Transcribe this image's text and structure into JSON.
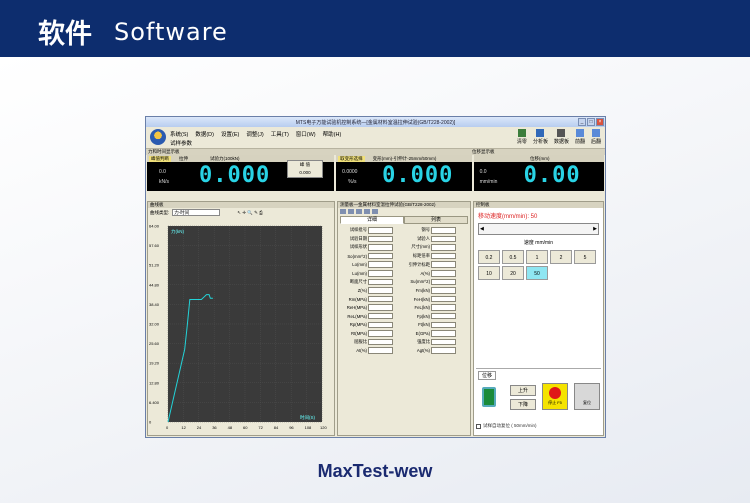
{
  "header": {
    "title_cn": "软件",
    "title_en": "Software"
  },
  "caption": "MaxTest-wew",
  "app": {
    "window_title": "MTS电子万能试验机控制系统—[金属材料室温拉伸试验(GB/T228-2002)]",
    "menus": [
      "系统(S)",
      "数据(D)",
      "设置(E)",
      "调整(J)",
      "工具(T)",
      "窗口(W)",
      "帮助(H)"
    ],
    "menu_second": "试样参数",
    "toolbar": [
      "清零",
      "分析板",
      "数据板",
      "前翻",
      "后翻"
    ],
    "strip_left": "力和时间显示板",
    "strip_right": "位移显示板",
    "meter1": {
      "tab_selected": "峰值判断",
      "tab2": "拉伸",
      "label": "试验力(100kN)",
      "small_a": "0.0",
      "unit": "kN/s",
      "value": "0.000",
      "popup_line1": "峰 值",
      "popup_line2": "0.000"
    },
    "meter2": {
      "tab": "取变形选择",
      "label": "变形(mm)-引伸计-25mm/50mm)",
      "small_a": "0.0000",
      "unit": "%/s",
      "value": "0.000"
    },
    "meter3": {
      "label": "位移(mm)",
      "small_a": "0.0",
      "unit": "mm/min",
      "value": "0.00"
    },
    "chart": {
      "panel_title": "曲线板",
      "type_label": "曲线类型:",
      "type_value": "力-时间",
      "y_unit": "力(kN)",
      "x_unit": "时间(S)",
      "y_ticks": [
        "64.00",
        "57.60",
        "51.20",
        "44.80",
        "38.40",
        "32.00",
        "25.60",
        "19.20",
        "12.80",
        "6.400",
        "0"
      ],
      "x_ticks": [
        "0",
        "12",
        "24",
        "36",
        "48",
        "60",
        "72",
        "84",
        "96",
        "108",
        "120"
      ]
    },
    "chart_data": {
      "type": "line",
      "xlabel": "时间(S)",
      "ylabel": "力(kN)",
      "xlim": [
        0,
        120
      ],
      "ylim": [
        0,
        64
      ],
      "series": [
        {
          "x": [
            0,
            13,
            15,
            17,
            26,
            28,
            30,
            31,
            32,
            33,
            35
          ],
          "values": [
            0,
            23.7,
            31.5,
            40.0,
            40.0,
            40.8,
            41.6,
            41.6,
            41.6,
            40.4,
            40.4
          ]
        }
      ]
    },
    "params": {
      "panel_title": "测量板—金属材料室温拉伸试验(GB/T228-2002)",
      "tabs": [
        "详细",
        "列表"
      ],
      "rows": [
        [
          "试样批号",
          "钢号"
        ],
        [
          "试验日期",
          "试验人"
        ],
        [
          "试样形状",
          "尺寸(mm)"
        ],
        [
          "So(mm^2)",
          "标距倍率"
        ],
        [
          "Lo(mm)",
          "引伸计标距"
        ],
        [
          "Lu(mm)",
          "A(%)"
        ],
        [
          "断面尺寸",
          "Su(mm^2)"
        ],
        [
          "Z(%)",
          "Fm(kN)"
        ],
        [
          "Rm(MPa)",
          "FeH(kN)"
        ],
        [
          "ReH(MPa)",
          "FeL(kN)"
        ],
        [
          "ReL(MPa)",
          "Fp(kN)"
        ],
        [
          "Rp(MPa)",
          "Ft(kN)"
        ],
        [
          "Rt(MPa)",
          "E(GPa)"
        ],
        [
          "屈服比",
          "强度比"
        ],
        [
          "At(%)",
          "Agt(%)"
        ]
      ]
    },
    "control": {
      "panel_title": "控制板",
      "speed_title": "移动速度(mm/min): 50",
      "speed_unit": "速度 mm/min",
      "speeds": [
        "0.2",
        "0.5",
        "1",
        "2",
        "5",
        "10",
        "20",
        "50"
      ],
      "speed_selected": "50",
      "tab": "位移",
      "up": "上升",
      "down": "下降",
      "stop": "停止 F5",
      "reset": "复位",
      "auto_reset": "试样自动复位 ( 50mm/min)"
    }
  }
}
